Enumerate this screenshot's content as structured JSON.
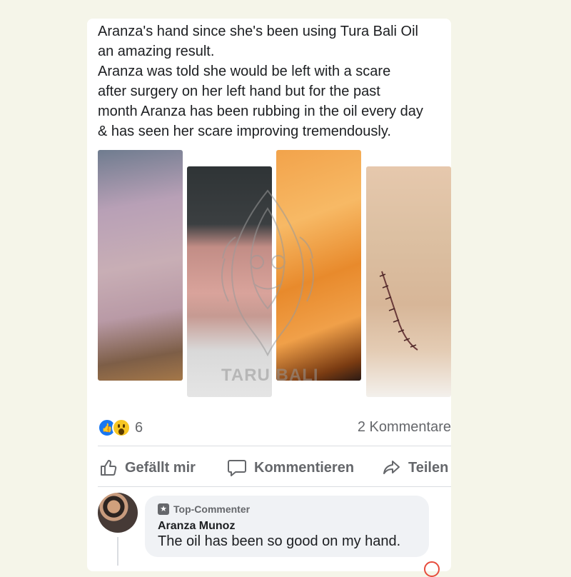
{
  "post": {
    "text_lines": [
      "Aranza's hand since she's been using Tura Bali Oil",
      "an amazing result.",
      "Aranza was told she would be left with a scare",
      "after surgery on her left hand but for the past",
      "month Aranza has been rubbing in the oil every day",
      "& has seen her scare improving tremendously."
    ],
    "watermark_text": "TARU BALI"
  },
  "reactions": {
    "icons": [
      "like-icon",
      "wow-icon"
    ],
    "count": "6",
    "comments": "2 Kommentare"
  },
  "actions": {
    "like": "Gefällt mir",
    "comment": "Kommentieren",
    "share": "Teilen"
  },
  "comment": {
    "badge": "Top-Commenter",
    "author": "Aranza Munoz",
    "text": "The oil has been so good on my hand."
  },
  "colors": {
    "page_bg": "#f5f5e9",
    "card_bg": "#ffffff",
    "text": "#1c1e21",
    "muted": "#65676b",
    "like_blue": "#1877f2",
    "bubble_bg": "#f0f2f5"
  }
}
